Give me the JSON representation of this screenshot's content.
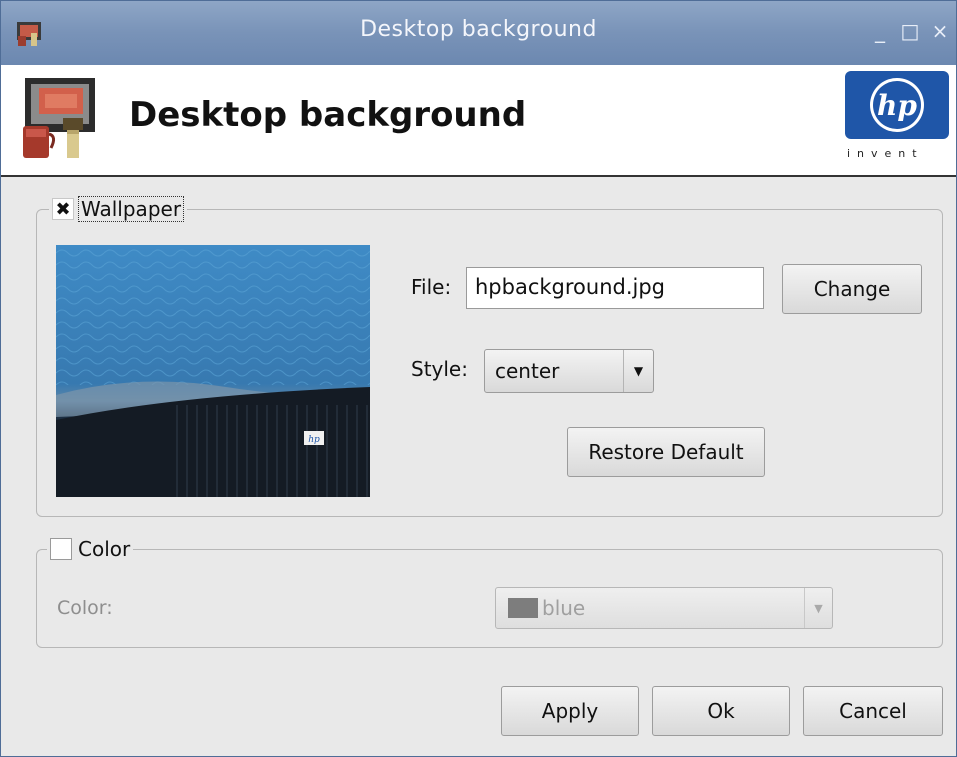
{
  "window": {
    "title": "Desktop background",
    "controls": {
      "minimize": "_",
      "maximize": "□",
      "close": "×"
    }
  },
  "header": {
    "heading": "Desktop background",
    "logo_tagline": "invent"
  },
  "wallpaper": {
    "legend_label": "Wallpaper",
    "checked": true,
    "check_mark": "✖",
    "file_label": "File:",
    "file_value": "hpbackground.jpg",
    "change_label": "Change",
    "style_label": "Style:",
    "style_value": "center",
    "restore_label": "Restore Default"
  },
  "color": {
    "legend_label": "Color",
    "checked": false,
    "color_label": "Color:",
    "color_value": "blue",
    "swatch_color": "#7d7d7d"
  },
  "footer": {
    "apply_label": "Apply",
    "ok_label": "Ok",
    "cancel_label": "Cancel"
  },
  "icons": {
    "dropdown_arrow": "▼",
    "app": "desktop-paint-icon",
    "logo": "hp-logo"
  },
  "colors": {
    "titlebar": "#7993b8",
    "window_bg": "#e9e9e9",
    "hp_blue": "#1f56a8"
  }
}
